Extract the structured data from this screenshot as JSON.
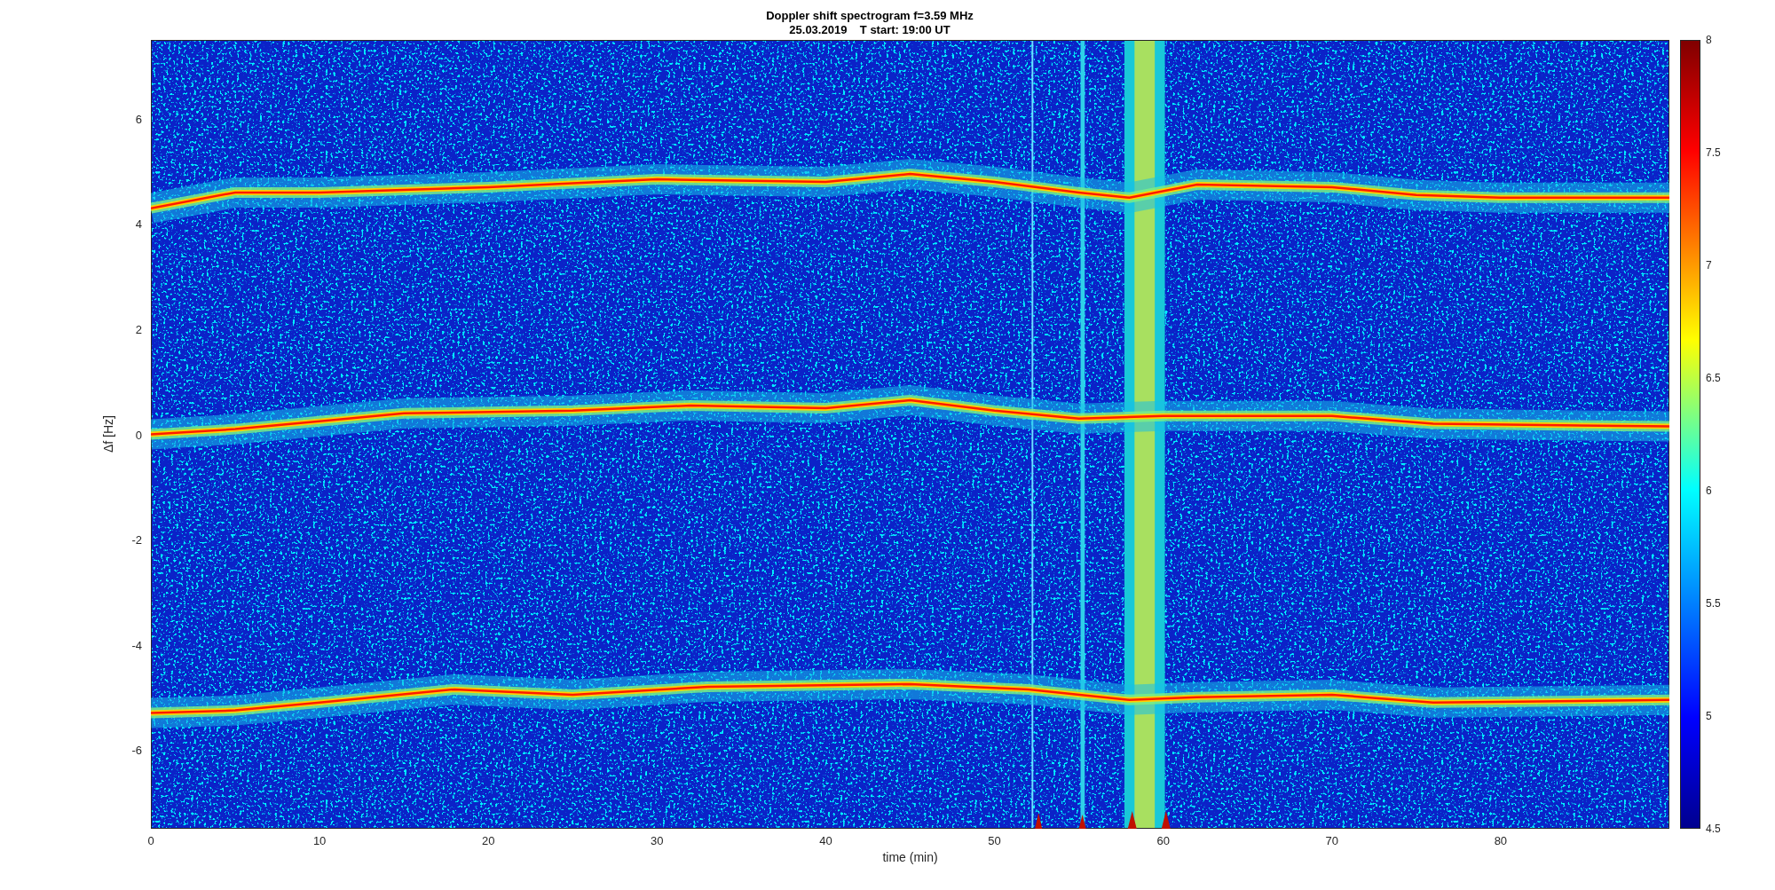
{
  "title_lines": [
    "Doppler shift spectrogram f=3.59 MHz",
    "25.03.2019    T start: 19:00 UT"
  ],
  "y_axis": {
    "label": "Δf [Hz]",
    "ticks": [
      "6",
      "4",
      "2",
      "0",
      "-2",
      "-4",
      "-6"
    ]
  },
  "x_axis": {
    "label": "time (min)",
    "ticks": [
      "0",
      "10",
      "20",
      "30",
      "40",
      "50",
      "60",
      "70",
      "80"
    ]
  },
  "colorbar": {
    "ticks": [
      "8",
      "7.5",
      "7",
      "6.5",
      "6",
      "5.5",
      "5",
      "4.5"
    ]
  }
}
